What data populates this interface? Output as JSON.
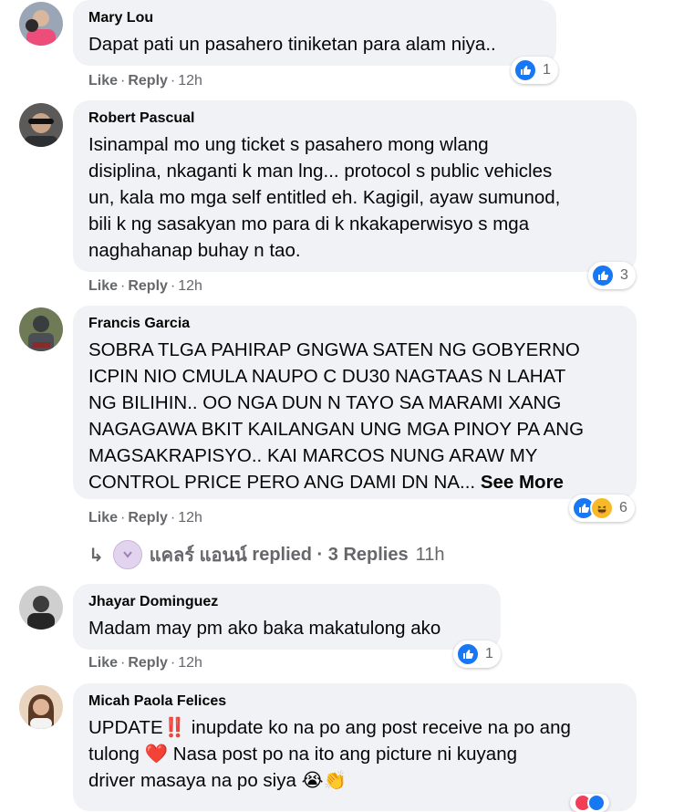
{
  "common": {
    "like": "Like",
    "reply": "Reply",
    "sep": "·"
  },
  "comments": [
    {
      "author": "Mary Lou",
      "text": "Dapat pati un pasahero tiniketan para alam niya..",
      "time": "12h",
      "reaction_count": "1",
      "reactions": [
        "like"
      ]
    },
    {
      "author": "Robert Pascual",
      "text": "Isinampal mo ung ticket s pasahero mong wlang\ndisiplina, nkaganti k man lng... protocol s public vehicles\nun, kala mo mga self entitled eh. Kagigil, ayaw sumunod,\nbili k ng sasakyan mo para di k nkakaperwisyo s mga\nnaghahanap buhay n tao.",
      "time": "12h",
      "reaction_count": "3",
      "reactions": [
        "like"
      ]
    },
    {
      "author": "Francis Garcia",
      "text": "SOBRA TLGA PAHIRAP GNGWA SATEN NG GOBYERNO\nICPIN NIO CMULA NAUPO C DU30 NAGTAAS N LAHAT\nNG BILIHIN.. OO NGA DUN N TAYO SA MARAMI XANG\nNAGAGAWA BKIT KAILANGAN UNG MGA PINOY PA ANG\nMAGSAKRAPISYO.. KAI MARCOS NUNG ARAW MY\nCONTROL PRICE PERO ANG DAMI DN NA... ",
      "see_more": "See More",
      "time": "12h",
      "reaction_count": "6",
      "reactions": [
        "like",
        "haha"
      ]
    },
    {
      "author": "Jhayar Dominguez",
      "text": "Madam may pm ako baka makatulong ako",
      "time": "12h",
      "reaction_count": "1",
      "reactions": [
        "like"
      ]
    },
    {
      "author": "Micah Paola Felices",
      "text_parts": [
        "UPDATE",
        "‼️",
        " inupdate ko na po ang post receive na po ang\ntulong ",
        "❤️",
        " Nasa post po na ito ang picture ni kuyang\ndriver masaya na po siya ",
        "😭👏"
      ]
    }
  ],
  "replies": {
    "author": "แคลร์ แอนน์",
    "label": "replied",
    "sep": "·",
    "count_text": "3 Replies",
    "time": "11h"
  },
  "colors": {
    "like": "#1877f2",
    "haha": "#f7b928",
    "bubble": "#f0f2f5",
    "muted": "#65676b"
  }
}
